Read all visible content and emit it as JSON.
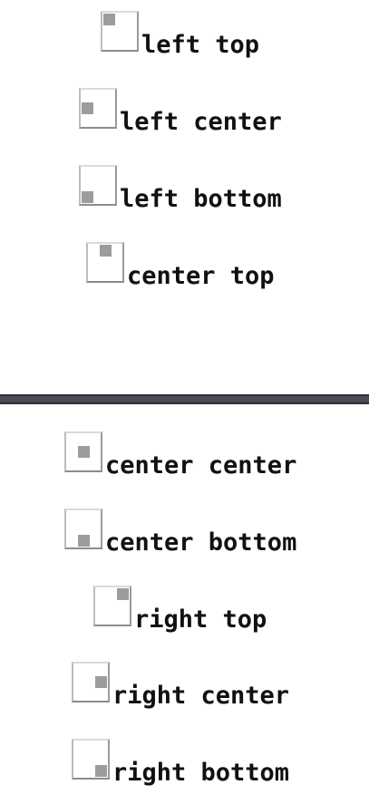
{
  "top_pane": {
    "items": [
      {
        "label": "left top",
        "position": "left-top"
      },
      {
        "label": "left center",
        "position": "left-center"
      },
      {
        "label": "left bottom",
        "position": "left-bottom"
      },
      {
        "label": "center top",
        "position": "center-top"
      }
    ]
  },
  "bottom_pane": {
    "items": [
      {
        "label": "center center",
        "position": "center-center"
      },
      {
        "label": "center bottom",
        "position": "center-bottom"
      },
      {
        "label": "right top",
        "position": "right-top"
      },
      {
        "label": "right center",
        "position": "right-center"
      },
      {
        "label": "right bottom",
        "position": "right-bottom"
      }
    ]
  },
  "colors": {
    "marker": "#9c9c9c",
    "divider": "#4a4e54",
    "text": "#111111"
  }
}
